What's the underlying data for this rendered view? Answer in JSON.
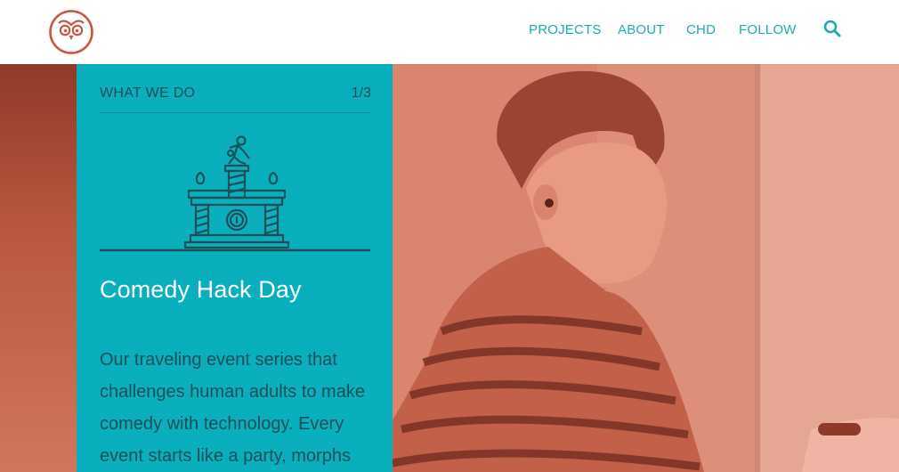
{
  "header": {
    "logo_icon": "owl-icon",
    "nav": {
      "projects_label": "PROJECTS",
      "about_label": "ABOUT",
      "chd_label": "CHD",
      "follow_label": "FOLLOW"
    },
    "search_icon": "search-icon"
  },
  "feature": {
    "section_label": "WHAT WE DO",
    "counter": "1/3",
    "illustration_icon": "trophy-podium-icon",
    "title": "Comedy Hack Day",
    "description": "Our traveling event series that challenges human adults to make comedy with technology. Every event starts like a party, morphs"
  },
  "colors": {
    "brand_orange": "#c8573f",
    "teal_panel": "#0aafbd",
    "nav_teal": "#1fa9b5",
    "panel_text": "#1d4f56"
  }
}
